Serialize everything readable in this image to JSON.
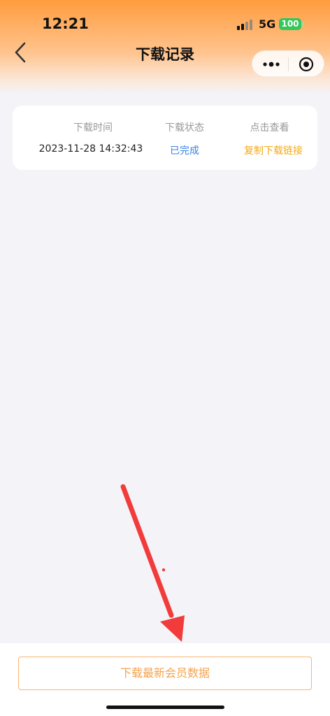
{
  "status_bar": {
    "time": "12:21",
    "network": "5G",
    "battery": "100"
  },
  "nav": {
    "title": "下载记录"
  },
  "records": {
    "headers": [
      "下载时间",
      "下载状态",
      "点击查看"
    ],
    "rows": [
      {
        "time": "2023-11-28 14:32:43",
        "status": "已完成",
        "action": "复制下载链接"
      }
    ]
  },
  "footer": {
    "download_label": "下载最新会员数据"
  },
  "colors": {
    "accent": "#ff9c3e",
    "status_done": "#3b82e0",
    "link": "#f3a91a",
    "annotation": "#f23b3b"
  },
  "icons": {
    "back": "chevron-left-icon",
    "more": "more-dots-icon",
    "close": "target-circle-icon"
  }
}
